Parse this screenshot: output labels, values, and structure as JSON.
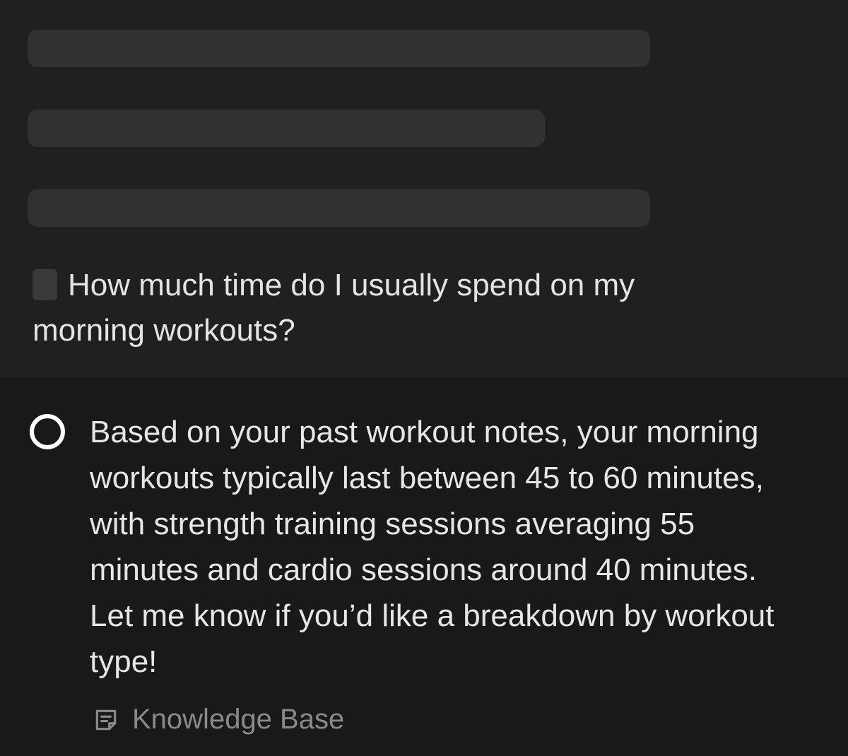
{
  "conversation": {
    "question": "How much time do I usually spend on my morning workouts?",
    "answer": "Based on your past workout notes, your morning workouts typically last between 45 to 60 minutes, with strength training sessions averaging 55 minutes and cardio sessions around 40 minutes. Let me know if you’d like a breakdown by workout type!",
    "source_label": "Knowledge Base",
    "source_icon": "note-icon"
  },
  "colors": {
    "background": "#202020",
    "answer_background": "#191919",
    "skeleton": "#313131",
    "text": "#e6e6e6",
    "muted_text": "#8a8a8a"
  }
}
